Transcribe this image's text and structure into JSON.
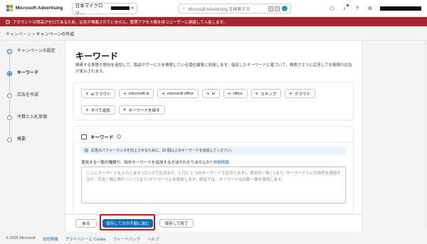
{
  "header": {
    "brand": "Microsoft Advertising",
    "account": "日本マイクロソ...",
    "search_placeholder": "Microsoft Advertising を検索する",
    "kbd_keys": [
      "G",
      "T"
    ]
  },
  "alert": {
    "text": "アカウントの残高がゼロであるため、広告が掲載されていません。管理アクセス権を持つユーザーに連絡して入金します。"
  },
  "breadcrumb": {
    "parent": "キャンペーン",
    "separator": ">",
    "current": "キャンペーンの作成"
  },
  "stepper": {
    "steps": [
      {
        "label": "キャンペーンの設定",
        "state": "done"
      },
      {
        "label": "キーワード",
        "state": "active"
      },
      {
        "label": "広告を作成",
        "state": "todo"
      },
      {
        "label": "予算と入札単価",
        "state": "todo"
      },
      {
        "label": "概要",
        "state": "todo"
      }
    ]
  },
  "main": {
    "title": "キーワード",
    "description": "関連する単語や語句を追加して、製品やサービスを検索している潜在顧客に到達します。指定したキーワードに基づいて、検索クエリに応答してお客様の広告が表示されます。"
  },
  "suggestions": {
    "chips": [
      "ai クラウド",
      "microsoft ai",
      "microsoft office",
      "ai",
      "office",
      "スキップ",
      "クラウド"
    ],
    "add_all": "すべて追加",
    "find_keywords": "キーワードを探す"
  },
  "keywords_section": {
    "title": "キーワード",
    "tip": "広告のパフォーマンスを向上させるために、20 個以上のキーワードを追加してください。",
    "question": "使用する一致の種類や、除外キーワードを追加する方法がわかりませんか?",
    "details_link": "詳細情報",
    "textarea_placeholder": "ここにキーワードを入力します (コンマで区切るか、1 行に 1 つのキーワードで区切ります)。語句の一致 (つまり \"キーワード\") に引用符を使用するか、完全一致に角かっこ (つまり [キーワード]) を使用します。既定では、キーワードは広範一致を使用します。"
  },
  "footer": {
    "back": "戻る",
    "save_next": "保存して次の手順に進む",
    "save_exit": "保存して終了"
  },
  "page_footer": {
    "copyright": "© 2025 Microsoft",
    "links": [
      "法的情報",
      "プライバシーと Cookie",
      "フィードバック",
      "ヘルプ"
    ]
  },
  "colors": {
    "accent": "#0f6cbd",
    "alert": "#a4262c",
    "highlight": "#d0101a"
  }
}
